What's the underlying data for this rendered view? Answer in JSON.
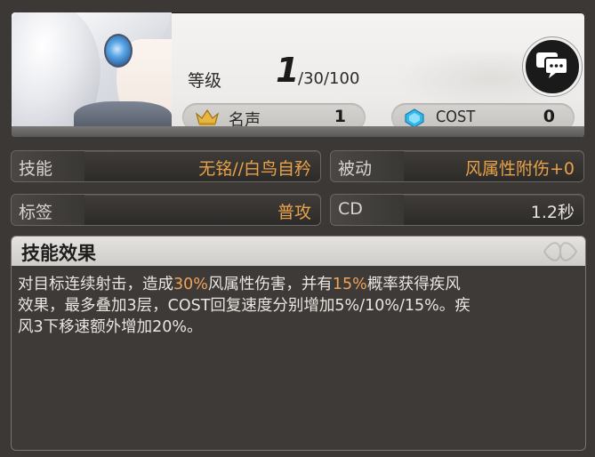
{
  "level": {
    "label": "等级",
    "current": "1",
    "max": "/30/100"
  },
  "fame": {
    "label": "名声",
    "value": "1",
    "icon": "crown-icon"
  },
  "cost": {
    "label": "COST",
    "value": "0",
    "icon": "crystal-icon"
  },
  "chat_button": {
    "icon": "chat-bubble-icon"
  },
  "rows": {
    "skill": {
      "key": "技能",
      "value": "无铭//白鸟自矜"
    },
    "passive": {
      "key": "被动",
      "value": "风属性附伤+0"
    },
    "tag": {
      "key": "标签",
      "value": "普攻"
    },
    "cd": {
      "key": "CD",
      "value": "1.2秒"
    }
  },
  "effect": {
    "title": "技能效果",
    "line1_a": "对目标连续射击，造成",
    "line1_hl1": "30%",
    "line1_b": "风属性伤害，并有",
    "line1_hl2": "15%",
    "line1_c": "概率获得疾风",
    "line2": "效果，最多叠加3层，COST回复速度分别增加5%/10%/15%。疾",
    "line3": "风3下移速额外增加20%。"
  },
  "colors": {
    "highlight": "#e8a24a",
    "panel": "#3d3a37",
    "header": "#e0dedb"
  }
}
